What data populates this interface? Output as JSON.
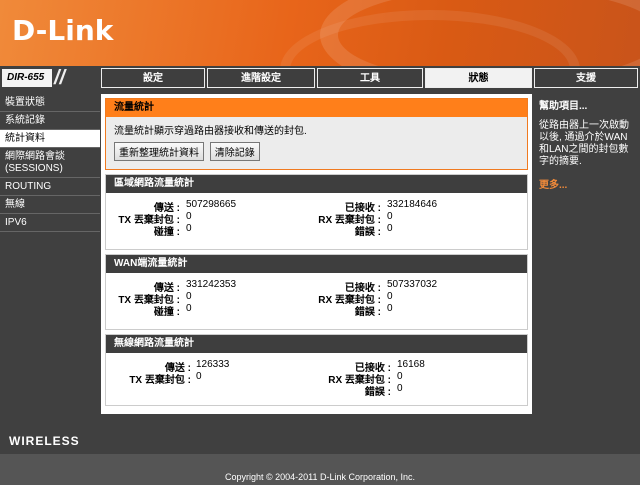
{
  "brand": "D-Link",
  "model": "DIR-655",
  "nav": {
    "tabs": [
      "設定",
      "進階設定",
      "工具",
      "狀態",
      "支援"
    ],
    "active": "狀態"
  },
  "sidebar": {
    "items": [
      "裝置狀態",
      "系統記錄",
      "統計資料",
      "網際網路會談 (SESSIONS)",
      "ROUTING",
      "無線",
      "IPV6"
    ],
    "active": "統計資料"
  },
  "intro": {
    "title": "流量統計",
    "description": "流量統計顯示穿過路由器接收和傳送的封包.",
    "refresh_button": "重新整理統計資料",
    "clear_button": "清除記錄"
  },
  "lan": {
    "title": "區域網路流量統計",
    "sent_label": "傳送 :",
    "sent": "507298665",
    "received_label": "已接收 :",
    "received": "332184646",
    "tx_drop_label": "TX 丟棄封包 :",
    "tx_drop": "0",
    "rx_drop_label": "RX 丟棄封包 :",
    "rx_drop": "0",
    "collision_label": "碰撞 :",
    "collision": "0",
    "error_label": "錯誤 :",
    "error": "0"
  },
  "wan": {
    "title": "WAN端流量統計",
    "sent_label": "傳送 :",
    "sent": "331242353",
    "received_label": "已接收 :",
    "received": "507337032",
    "tx_drop_label": "TX 丟棄封包 :",
    "tx_drop": "0",
    "rx_drop_label": "RX 丟棄封包 :",
    "rx_drop": "0",
    "collision_label": "碰撞 :",
    "collision": "0",
    "error_label": "錯誤 :",
    "error": "0"
  },
  "wlan": {
    "title": "無線網路流量統計",
    "sent_label": "傳送 :",
    "sent": "126333",
    "received_label": "已接收 :",
    "received": "16168",
    "tx_drop_label": "TX 丟棄封包 :",
    "tx_drop": "0",
    "rx_drop_label": "RX 丟棄封包 :",
    "rx_drop": "0",
    "error_label": "錯誤 :",
    "error": "0"
  },
  "help": {
    "title": "幫助項目...",
    "text": "從路由器上一次啟動以後, 通過介於WAN和LAN之間的封包數字的摘要.",
    "more": "更多..."
  },
  "footer": {
    "wireless": "WIRELESS",
    "copyright": "Copyright © 2004-2011 D-Link Corporation, Inc."
  },
  "colors": {
    "accent": "#ff7f1a",
    "dark": "#404040"
  }
}
